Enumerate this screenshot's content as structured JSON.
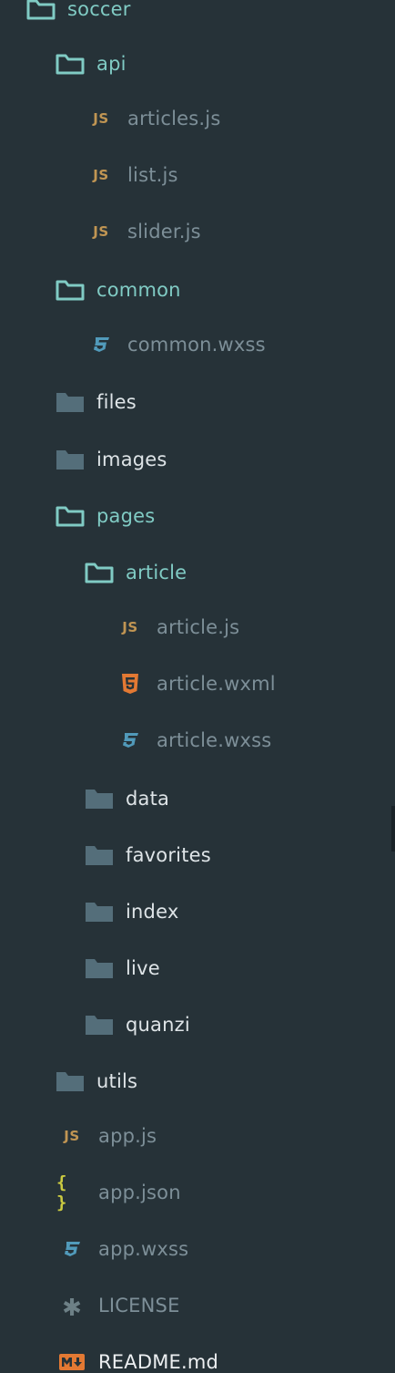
{
  "tree": {
    "items": [
      {
        "label": "soccer",
        "icon": "folder-open-icon"
      },
      {
        "label": "api",
        "icon": "folder-open-icon"
      },
      {
        "label": "articles.js",
        "icon": "js-file-icon"
      },
      {
        "label": "list.js",
        "icon": "js-file-icon"
      },
      {
        "label": "slider.js",
        "icon": "js-file-icon"
      },
      {
        "label": "common",
        "icon": "folder-open-icon"
      },
      {
        "label": "common.wxss",
        "icon": "css-file-icon"
      },
      {
        "label": "files",
        "icon": "folder-closed-icon"
      },
      {
        "label": "images",
        "icon": "folder-closed-icon"
      },
      {
        "label": "pages",
        "icon": "folder-open-icon"
      },
      {
        "label": "article",
        "icon": "folder-open-icon"
      },
      {
        "label": "article.js",
        "icon": "js-file-icon"
      },
      {
        "label": "article.wxml",
        "icon": "html5-file-icon"
      },
      {
        "label": "article.wxss",
        "icon": "css-file-icon"
      },
      {
        "label": "data",
        "icon": "folder-closed-icon"
      },
      {
        "label": "favorites",
        "icon": "folder-closed-icon"
      },
      {
        "label": "index",
        "icon": "folder-closed-icon"
      },
      {
        "label": "live",
        "icon": "folder-closed-icon"
      },
      {
        "label": "quanzi",
        "icon": "folder-closed-icon"
      },
      {
        "label": "utils",
        "icon": "folder-closed-icon"
      },
      {
        "label": "app.js",
        "icon": "js-file-icon"
      },
      {
        "label": "app.json",
        "icon": "json-file-icon"
      },
      {
        "label": "app.wxss",
        "icon": "css-file-icon"
      },
      {
        "label": "LICENSE",
        "icon": "asterisk-file-icon"
      },
      {
        "label": "README.md",
        "icon": "markdown-file-icon"
      }
    ],
    "icon_glyphs": {
      "js": "JS",
      "json": "{ }",
      "asterisk": "✱"
    },
    "colors": {
      "background": "#263238",
      "open_folder": "#80cbc4",
      "closed_folder": "#546e7a",
      "folder_label": "#dee4e7",
      "file_label": "#7d8f98",
      "js": "#c09553",
      "css": "#519aba",
      "html": "#e37933",
      "markdown": "#e37933"
    }
  }
}
